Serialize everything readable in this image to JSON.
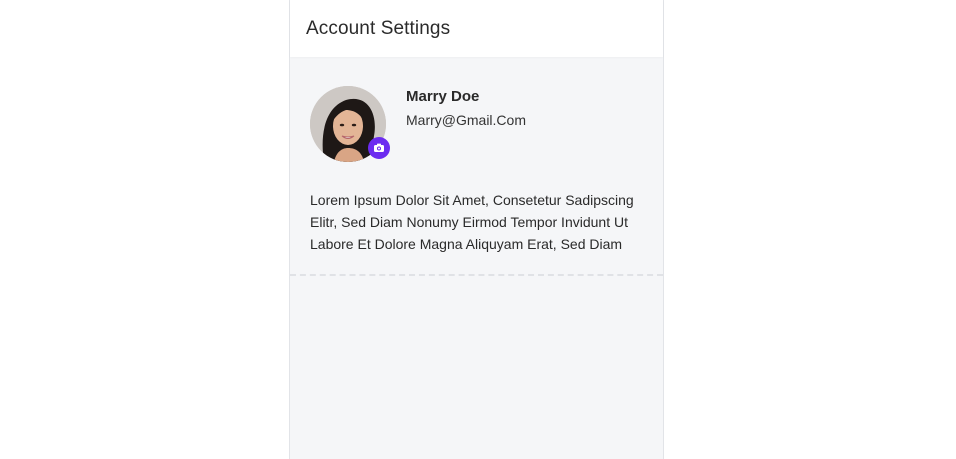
{
  "header": {
    "title": "Account Settings"
  },
  "profile": {
    "name": "Marry Doe",
    "email": "Marry@Gmail.Com",
    "avatar_icon": "user-photo",
    "camera_icon": "camera-icon",
    "badge_color": "#6c2bf0"
  },
  "bio": {
    "text": "Lorem Ipsum Dolor Sit Amet, Consetetur Sadipscing Elitr, Sed Diam Nonumy Eirmod Tempor Invidunt Ut Labore Et Dolore Magna Aliquyam Erat, Sed Diam"
  }
}
